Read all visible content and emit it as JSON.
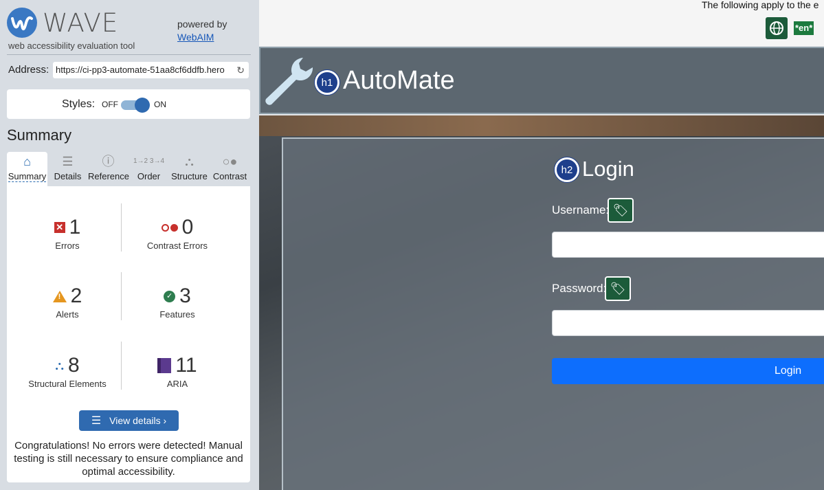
{
  "wave": {
    "brand": "WAVE",
    "tagline": "web accessibility evaluation tool",
    "powered_by": "powered by",
    "powered_link": "WebAIM",
    "address_label": "Address:",
    "address_value": "https://ci-pp3-automate-51aa8cf6ddfb.hero",
    "styles_label": "Styles:",
    "styles_off": "OFF",
    "styles_on": "ON",
    "summary_title": "Summary",
    "tabs": [
      {
        "label": "Summary",
        "icon": "home-icon"
      },
      {
        "label": "Details",
        "icon": "list-icon"
      },
      {
        "label": "Reference",
        "icon": "info-icon"
      },
      {
        "label": "Order",
        "icon": "order-icon"
      },
      {
        "label": "Structure",
        "icon": "structure-icon"
      },
      {
        "label": "Contrast",
        "icon": "contrast-icon"
      }
    ],
    "stats": {
      "errors": {
        "count": "1",
        "label": "Errors"
      },
      "contrast_errors": {
        "count": "0",
        "label": "Contrast Errors"
      },
      "alerts": {
        "count": "2",
        "label": "Alerts"
      },
      "features": {
        "count": "3",
        "label": "Features"
      },
      "structural": {
        "count": "8",
        "label": "Structural Elements"
      },
      "aria": {
        "count": "11",
        "label": "ARIA"
      }
    },
    "view_details": "View details ›",
    "congrats": "Congratulations! No errors were detected! Manual testing is still necessary to ensure compliance and optimal accessibility."
  },
  "page": {
    "top_text": "The following apply to the e",
    "lang_badge": "*en*",
    "h1_badge": "h1",
    "app_title": "AutoMate",
    "h2_badge": "h2",
    "login_title": "Login",
    "username_label": "Username:",
    "password_label": "Password:",
    "login_button": "Login"
  },
  "colors": {
    "wave_blue": "#2f6ab0",
    "error_red": "#c7302c",
    "alert_orange": "#e5961f",
    "feature_green": "#2e7d4f",
    "aria_purple": "#5b3a8e",
    "login_blue": "#0d6efd"
  }
}
